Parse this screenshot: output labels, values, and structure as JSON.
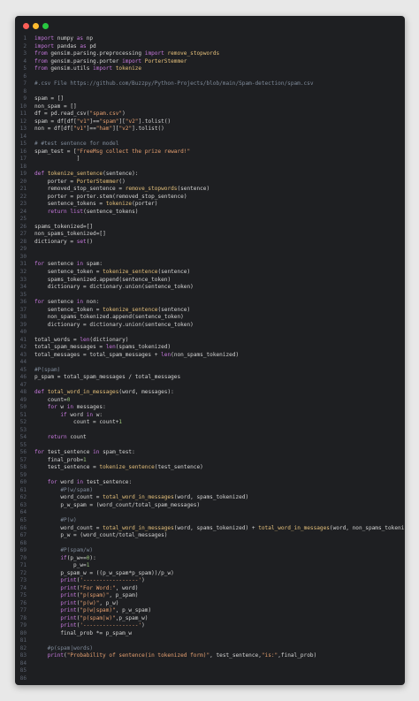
{
  "window": {
    "controls": [
      "close",
      "minimize",
      "maximize"
    ]
  },
  "editor": {
    "lines": [
      {
        "n": "1",
        "t": "import numpy as np",
        "k": "code"
      },
      {
        "n": "2",
        "t": "import pandas as pd",
        "k": "code"
      },
      {
        "n": "3",
        "t": "from gensim.parsing.preprocessing import remove_stopwords",
        "k": "code"
      },
      {
        "n": "4",
        "t": "from gensim.parsing.porter import PorterStemmer",
        "k": "code"
      },
      {
        "n": "5",
        "t": "from gensim.utils import tokenize",
        "k": "code"
      },
      {
        "n": "6",
        "t": "",
        "k": "code"
      },
      {
        "n": "7",
        "t": "#.csv File https://github.com/Buzzpy/Python-Projects/blob/main/Spam-detection/spam.csv",
        "k": "comment"
      },
      {
        "n": "8",
        "t": "",
        "k": "code"
      },
      {
        "n": "9",
        "t": "spam = []",
        "k": "code"
      },
      {
        "n": "10",
        "t": "non_spam = []",
        "k": "code"
      },
      {
        "n": "11",
        "t": "df = pd.read_csv(\"spam.csv\")",
        "k": "code"
      },
      {
        "n": "12",
        "t": "spam = df[df[\"v1\"]==\"spam\"][\"v2\"].tolist()",
        "k": "code"
      },
      {
        "n": "13",
        "t": "non = df[df[\"v1\"]==\"ham\"][\"v2\"].tolist()",
        "k": "code"
      },
      {
        "n": "14",
        "t": "",
        "k": "code"
      },
      {
        "n": "15",
        "t": "# #test sentence for model",
        "k": "comment"
      },
      {
        "n": "16",
        "t": "spam_test = [\"FreeMsg collect the prize reward!\"",
        "k": "code"
      },
      {
        "n": "17",
        "t": "             ]",
        "k": "code"
      },
      {
        "n": "18",
        "t": "",
        "k": "code"
      },
      {
        "n": "19",
        "t": "def tokenize_sentence(sentence):",
        "k": "code"
      },
      {
        "n": "20",
        "t": "    porter = PorterStemmer()",
        "k": "code"
      },
      {
        "n": "21",
        "t": "    removed_stop_sentence = remove_stopwords(sentence)",
        "k": "code"
      },
      {
        "n": "22",
        "t": "    porter = porter.stem(removed_stop_sentence)",
        "k": "code"
      },
      {
        "n": "23",
        "t": "    sentence_tokens = tokenize(porter)",
        "k": "code"
      },
      {
        "n": "24",
        "t": "    return list(sentence_tokens)",
        "k": "code"
      },
      {
        "n": "25",
        "t": "",
        "k": "code"
      },
      {
        "n": "26",
        "t": "spams_tokenized=[]",
        "k": "code"
      },
      {
        "n": "27",
        "t": "non_spams_tokenized=[]",
        "k": "code"
      },
      {
        "n": "28",
        "t": "dictionary = set()",
        "k": "code"
      },
      {
        "n": "29",
        "t": "",
        "k": "code"
      },
      {
        "n": "30",
        "t": "",
        "k": "code"
      },
      {
        "n": "31",
        "t": "for sentence in spam:",
        "k": "code"
      },
      {
        "n": "32",
        "t": "    sentence_token = tokenize_sentence(sentence)",
        "k": "code"
      },
      {
        "n": "33",
        "t": "    spams_tokenized.append(sentence_token)",
        "k": "code"
      },
      {
        "n": "34",
        "t": "    dictionary = dictionary.union(sentence_token)",
        "k": "code"
      },
      {
        "n": "35",
        "t": "",
        "k": "code"
      },
      {
        "n": "36",
        "t": "for sentence in non:",
        "k": "code"
      },
      {
        "n": "37",
        "t": "    sentence_token = tokenize_sentence(sentence)",
        "k": "code"
      },
      {
        "n": "38",
        "t": "    non_spams_tokenized.append(sentence_token)",
        "k": "code"
      },
      {
        "n": "39",
        "t": "    dictionary = dictionary.union(sentence_token)",
        "k": "code"
      },
      {
        "n": "40",
        "t": "",
        "k": "code"
      },
      {
        "n": "41",
        "t": "total_words = len(dictionary)",
        "k": "code"
      },
      {
        "n": "42",
        "t": "total_spam_messages = len(spams_tokenized)",
        "k": "code"
      },
      {
        "n": "43",
        "t": "total_messages = total_spam_messages + len(non_spams_tokenized)",
        "k": "code"
      },
      {
        "n": "44",
        "t": "",
        "k": "code"
      },
      {
        "n": "45",
        "t": "#P(spam)",
        "k": "comment"
      },
      {
        "n": "46",
        "t": "p_spam = total_spam_messages / total_messages",
        "k": "code"
      },
      {
        "n": "47",
        "t": "",
        "k": "code"
      },
      {
        "n": "48",
        "t": "def total_word_in_messages(word, messages):",
        "k": "code"
      },
      {
        "n": "49",
        "t": "    count=0",
        "k": "code"
      },
      {
        "n": "50",
        "t": "    for w in messages:",
        "k": "code"
      },
      {
        "n": "51",
        "t": "        if word in w:",
        "k": "code"
      },
      {
        "n": "52",
        "t": "            count = count+1",
        "k": "code"
      },
      {
        "n": "53",
        "t": "",
        "k": "code"
      },
      {
        "n": "54",
        "t": "    return count",
        "k": "code"
      },
      {
        "n": "55",
        "t": "",
        "k": "code"
      },
      {
        "n": "56",
        "t": "for test_sentence in spam_test:",
        "k": "code"
      },
      {
        "n": "57",
        "t": "    final_prob=1",
        "k": "code"
      },
      {
        "n": "58",
        "t": "    test_sentence = tokenize_sentence(test_sentence)",
        "k": "code"
      },
      {
        "n": "59",
        "t": "",
        "k": "code"
      },
      {
        "n": "60",
        "t": "    for word in test_sentence:",
        "k": "code"
      },
      {
        "n": "61",
        "t": "        #P(w/spam)",
        "k": "comment"
      },
      {
        "n": "62",
        "t": "        word_count = total_word_in_messages(word, spams_tokenized)",
        "k": "code"
      },
      {
        "n": "63",
        "t": "        p_w_spam = (word_count/total_spam_messages)",
        "k": "code"
      },
      {
        "n": "64",
        "t": "",
        "k": "code"
      },
      {
        "n": "65",
        "t": "        #P(w)",
        "k": "comment"
      },
      {
        "n": "66",
        "t": "        word_count = total_word_in_messages(word, spams_tokenized) + total_word_in_messages(word, non_spams_tokenized)",
        "k": "code"
      },
      {
        "n": "67",
        "t": "        p_w = (word_count/total_messages)",
        "k": "code"
      },
      {
        "n": "68",
        "t": "",
        "k": "code"
      },
      {
        "n": "69",
        "t": "        #P(spam/w)",
        "k": "comment"
      },
      {
        "n": "70",
        "t": "        if(p_w==0):",
        "k": "code"
      },
      {
        "n": "71",
        "t": "            p_w=1",
        "k": "code"
      },
      {
        "n": "72",
        "t": "        p_spam_w = ((p_w_spam*p_spam))/p_w)",
        "k": "code"
      },
      {
        "n": "73",
        "t": "        print('-----------------')",
        "k": "code"
      },
      {
        "n": "74",
        "t": "        print(\"For Word:\", word)",
        "k": "code"
      },
      {
        "n": "75",
        "t": "        print(\"p(spam)\", p_spam)",
        "k": "code"
      },
      {
        "n": "76",
        "t": "        print(\"p(w)\", p_w)",
        "k": "code"
      },
      {
        "n": "77",
        "t": "        print(\"p(w|spam)\", p_w_spam)",
        "k": "code"
      },
      {
        "n": "78",
        "t": "        print(\"p(spam|w)\",p_spam_w)",
        "k": "code"
      },
      {
        "n": "79",
        "t": "        print('-----------------')",
        "k": "code"
      },
      {
        "n": "80",
        "t": "        final_prob *= p_spam_w",
        "k": "code"
      },
      {
        "n": "81",
        "t": "",
        "k": "code"
      },
      {
        "n": "82",
        "t": "    #p(spam|words)",
        "k": "comment"
      },
      {
        "n": "83",
        "t": "    print(\"Probability of sentence(in tokenized form)\", test_sentence,\"is:\",final_prob)",
        "k": "code"
      },
      {
        "n": "84",
        "t": "",
        "k": "code"
      },
      {
        "n": "85",
        "t": "",
        "k": "code"
      },
      {
        "n": "86",
        "t": "",
        "k": "code"
      }
    ]
  }
}
